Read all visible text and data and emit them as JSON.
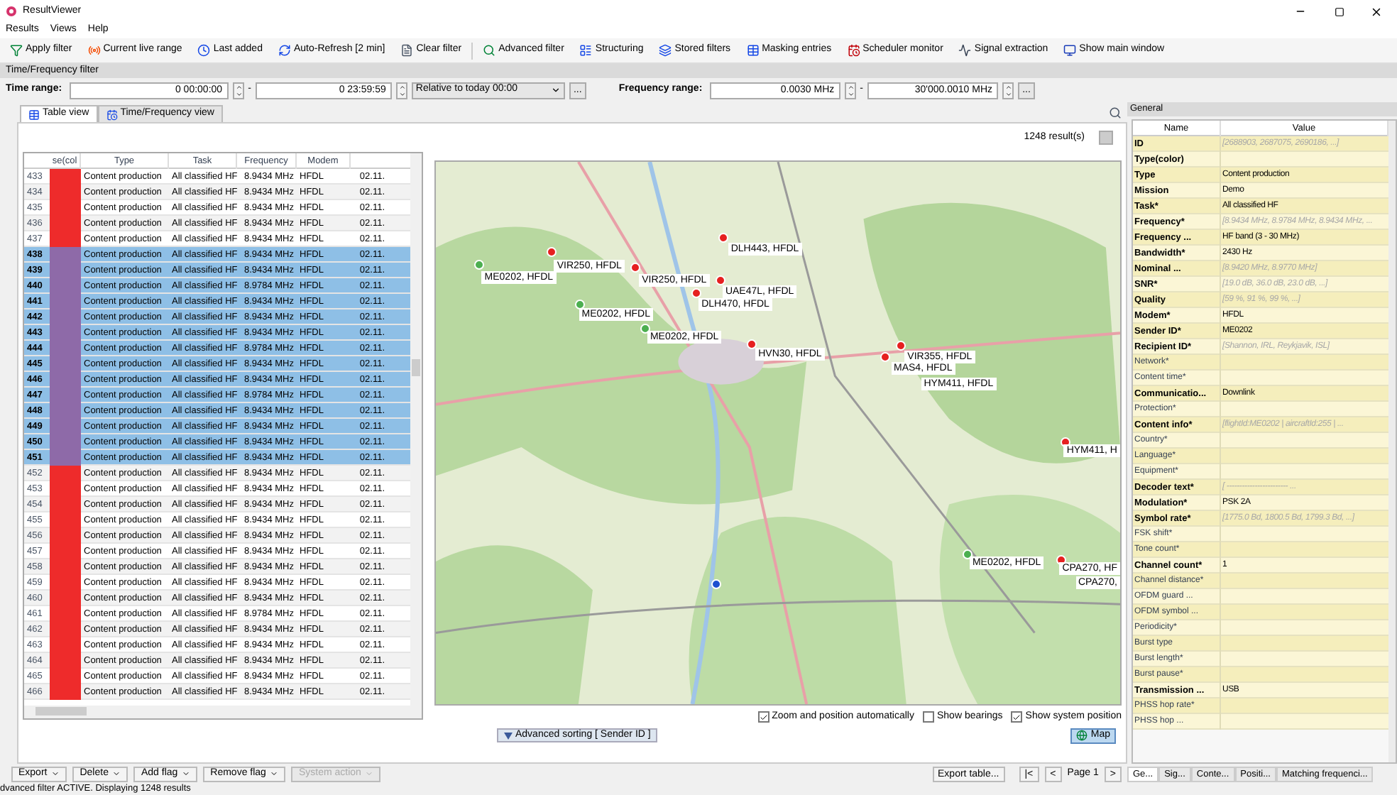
{
  "window": {
    "title": "ResultViewer"
  },
  "menu": [
    "Results",
    "Views",
    "Help"
  ],
  "toolbar": [
    {
      "kind": "apply",
      "label": "Apply filter"
    },
    {
      "kind": "live",
      "label": "Current live range"
    },
    {
      "kind": "last",
      "label": "Last added"
    },
    {
      "kind": "refresh",
      "label": "Auto-Refresh [2 min]"
    },
    {
      "kind": "clear",
      "label": "Clear filter"
    },
    {
      "kind": "advanced",
      "label": "Advanced filter"
    },
    {
      "kind": "structuring",
      "label": "Structuring"
    },
    {
      "kind": "stored",
      "label": "Stored filters"
    },
    {
      "kind": "masking",
      "label": "Masking entries"
    },
    {
      "kind": "scheduler",
      "label": "Scheduler monitor"
    },
    {
      "kind": "signal",
      "label": "Signal extraction"
    },
    {
      "kind": "main",
      "label": "Show main window"
    }
  ],
  "filter": {
    "title": "Time/Frequency filter",
    "time_label": "Time range:",
    "time_from": "0 00:00:00",
    "time_to": "0 23:59:59",
    "relative": "Relative to today 00:00",
    "more": "...",
    "separator": "-",
    "freq_label": "Frequency range:",
    "freq_from": "0.0030 MHz",
    "freq_to": "30'000.0010 MHz"
  },
  "tabs": [
    {
      "label": "Table view",
      "selected": true
    },
    {
      "label": "Time/Frequency view",
      "selected": false
    }
  ],
  "results_count": "1248 result(s)",
  "table": {
    "columns": [
      "se(col",
      "Type",
      "Task",
      "Frequency",
      "Modem"
    ],
    "rows": [
      {
        "cells": [
          "433",
          "Content production",
          "All classified HF",
          "8.9434 MHz",
          "HFDL",
          "02.11."
        ],
        "color": "#ee2b2b",
        "selected": false
      },
      {
        "cells": [
          "434",
          "Content production",
          "All classified HF",
          "8.9434 MHz",
          "HFDL",
          "02.11."
        ],
        "color": "#ee2b2b",
        "selected": false
      },
      {
        "cells": [
          "435",
          "Content production",
          "All classified HF",
          "8.9434 MHz",
          "HFDL",
          "02.11."
        ],
        "color": "#ee2b2b",
        "selected": false
      },
      {
        "cells": [
          "436",
          "Content production",
          "All classified HF",
          "8.9434 MHz",
          "HFDL",
          "02.11."
        ],
        "color": "#ee2b2b",
        "selected": false
      },
      {
        "cells": [
          "437",
          "Content production",
          "All classified HF",
          "8.9434 MHz",
          "HFDL",
          "02.11."
        ],
        "color": "#ee2b2b",
        "selected": false
      },
      {
        "cells": [
          "438",
          "Content production",
          "All classified HF",
          "8.9434 MHz",
          "HFDL",
          "02.11."
        ],
        "color": "#8e6aa8",
        "selected": true
      },
      {
        "cells": [
          "439",
          "Content production",
          "All classified HF",
          "8.9434 MHz",
          "HFDL",
          "02.11."
        ],
        "color": "#8e6aa8",
        "selected": true
      },
      {
        "cells": [
          "440",
          "Content production",
          "All classified HF",
          "8.9784 MHz",
          "HFDL",
          "02.11."
        ],
        "color": "#8e6aa8",
        "selected": true
      },
      {
        "cells": [
          "441",
          "Content production",
          "All classified HF",
          "8.9434 MHz",
          "HFDL",
          "02.11."
        ],
        "color": "#8e6aa8",
        "selected": true
      },
      {
        "cells": [
          "442",
          "Content production",
          "All classified HF",
          "8.9434 MHz",
          "HFDL",
          "02.11."
        ],
        "color": "#8e6aa8",
        "selected": true
      },
      {
        "cells": [
          "443",
          "Content production",
          "All classified HF",
          "8.9434 MHz",
          "HFDL",
          "02.11."
        ],
        "color": "#8e6aa8",
        "selected": true
      },
      {
        "cells": [
          "444",
          "Content production",
          "All classified HF",
          "8.9784 MHz",
          "HFDL",
          "02.11."
        ],
        "color": "#8e6aa8",
        "selected": true
      },
      {
        "cells": [
          "445",
          "Content production",
          "All classified HF",
          "8.9434 MHz",
          "HFDL",
          "02.11."
        ],
        "color": "#8e6aa8",
        "selected": true
      },
      {
        "cells": [
          "446",
          "Content production",
          "All classified HF",
          "8.9434 MHz",
          "HFDL",
          "02.11."
        ],
        "color": "#8e6aa8",
        "selected": true
      },
      {
        "cells": [
          "447",
          "Content production",
          "All classified HF",
          "8.9784 MHz",
          "HFDL",
          "02.11."
        ],
        "color": "#8e6aa8",
        "selected": true
      },
      {
        "cells": [
          "448",
          "Content production",
          "All classified HF",
          "8.9434 MHz",
          "HFDL",
          "02.11."
        ],
        "color": "#8e6aa8",
        "selected": true
      },
      {
        "cells": [
          "449",
          "Content production",
          "All classified HF",
          "8.9434 MHz",
          "HFDL",
          "02.11."
        ],
        "color": "#8e6aa8",
        "selected": true
      },
      {
        "cells": [
          "450",
          "Content production",
          "All classified HF",
          "8.9434 MHz",
          "HFDL",
          "02.11."
        ],
        "color": "#8e6aa8",
        "selected": true
      },
      {
        "cells": [
          "451",
          "Content production",
          "All classified HF",
          "8.9434 MHz",
          "HFDL",
          "02.11."
        ],
        "color": "#8e6aa8",
        "selected": true
      },
      {
        "cells": [
          "452",
          "Content production",
          "All classified HF",
          "8.9434 MHz",
          "HFDL",
          "02.11."
        ],
        "color": "#ee2b2b",
        "selected": false
      },
      {
        "cells": [
          "453",
          "Content production",
          "All classified HF",
          "8.9434 MHz",
          "HFDL",
          "02.11."
        ],
        "color": "#ee2b2b",
        "selected": false
      },
      {
        "cells": [
          "454",
          "Content production",
          "All classified HF",
          "8.9434 MHz",
          "HFDL",
          "02.11."
        ],
        "color": "#ee2b2b",
        "selected": false
      },
      {
        "cells": [
          "455",
          "Content production",
          "All classified HF",
          "8.9434 MHz",
          "HFDL",
          "02.11."
        ],
        "color": "#ee2b2b",
        "selected": false
      },
      {
        "cells": [
          "456",
          "Content production",
          "All classified HF",
          "8.9434 MHz",
          "HFDL",
          "02.11."
        ],
        "color": "#ee2b2b",
        "selected": false
      },
      {
        "cells": [
          "457",
          "Content production",
          "All classified HF",
          "8.9434 MHz",
          "HFDL",
          "02.11."
        ],
        "color": "#ee2b2b",
        "selected": false
      },
      {
        "cells": [
          "458",
          "Content production",
          "All classified HF",
          "8.9434 MHz",
          "HFDL",
          "02.11."
        ],
        "color": "#ee2b2b",
        "selected": false
      },
      {
        "cells": [
          "459",
          "Content production",
          "All classified HF",
          "8.9434 MHz",
          "HFDL",
          "02.11."
        ],
        "color": "#ee2b2b",
        "selected": false
      },
      {
        "cells": [
          "460",
          "Content production",
          "All classified HF",
          "8.9434 MHz",
          "HFDL",
          "02.11."
        ],
        "color": "#ee2b2b",
        "selected": false
      },
      {
        "cells": [
          "461",
          "Content production",
          "All classified HF",
          "8.9784 MHz",
          "HFDL",
          "02.11."
        ],
        "color": "#ee2b2b",
        "selected": false
      },
      {
        "cells": [
          "462",
          "Content production",
          "All classified HF",
          "8.9434 MHz",
          "HFDL",
          "02.11."
        ],
        "color": "#ee2b2b",
        "selected": false
      },
      {
        "cells": [
          "463",
          "Content production",
          "All classified HF",
          "8.9434 MHz",
          "HFDL",
          "02.11."
        ],
        "color": "#ee2b2b",
        "selected": false
      },
      {
        "cells": [
          "464",
          "Content production",
          "All classified HF",
          "8.9434 MHz",
          "HFDL",
          "02.11."
        ],
        "color": "#ee2b2b",
        "selected": false
      },
      {
        "cells": [
          "465",
          "Content production",
          "All classified HF",
          "8.9434 MHz",
          "HFDL",
          "02.11."
        ],
        "color": "#ee2b2b",
        "selected": false
      },
      {
        "cells": [
          "466",
          "Content production",
          "All classified HF",
          "8.9434 MHz",
          "HFDL",
          "02.11."
        ],
        "color": "#ee2b2b",
        "selected": false
      }
    ]
  },
  "map": {
    "kind": "picture",
    "markers": [
      {
        "color": "#4caf50"
      },
      {
        "color": "#e62020"
      },
      {
        "color": "#e62020"
      },
      {
        "color": "#e62020"
      },
      {
        "color": "#e62020"
      },
      {
        "color": "#e62020"
      },
      {
        "color": "#4caf50"
      },
      {
        "color": "#4caf50"
      },
      {
        "color": "#e62020"
      },
      {
        "color": "#e62020"
      },
      {
        "color": "#e62020"
      },
      {
        "color": "#e62020"
      },
      {
        "color": "#4caf50"
      },
      {
        "color": "#e62020"
      },
      {
        "color": "#1e4fd0"
      }
    ],
    "labels": [
      "ME0202, HFDL",
      "VIR250, HFDL",
      "VIR250, HFDL",
      "DLH443, HFDL",
      "UAE47L, HFDL",
      "DLH470, HFDL",
      "ME0202, HFDL",
      "ME0202, HFDL",
      "HVN30, HFDL",
      "VIR355, HFDL",
      "MAS4, HFDL",
      "HYM411, HFDL",
      "HYM411, H",
      "ME0202, HFDL",
      "CPA270, HF",
      "CPA270,"
    ]
  },
  "map_options": [
    {
      "label": "Zoom and position automatically",
      "checked": true
    },
    {
      "label": "Show bearings",
      "checked": false
    },
    {
      "label": "Show system position",
      "checked": true
    }
  ],
  "sorting_button": "Advanced sorting [ Sender ID ]",
  "map_button": "Map",
  "actions": [
    {
      "label": "Export",
      "disabled": false
    },
    {
      "label": "Delete",
      "disabled": false
    },
    {
      "label": "Add flag",
      "disabled": false
    },
    {
      "label": "Remove flag",
      "disabled": false
    },
    {
      "label": "System action",
      "disabled": true
    }
  ],
  "export_table": "Export table...",
  "pagination": {
    "first": "|<",
    "prev": "<",
    "page": "Page 1",
    "next": ">"
  },
  "status_bar": "dvanced filter ACTIVE. Displaying 1248 results",
  "panel": {
    "title": "General",
    "columns": [
      "Name",
      "Value"
    ],
    "rows": [
      {
        "name": "ID",
        "value": "[2688903, 2687075, 2690186, ...]",
        "bold": true,
        "multiple": true
      },
      {
        "name": "Type(color)",
        "bold": true
      },
      {
        "name": "Type",
        "value": "Content production",
        "bold": true,
        "multiple": false
      },
      {
        "name": "Mission",
        "value": "Demo",
        "bold": true,
        "multiple": false
      },
      {
        "name": "Task*",
        "value": "All classified HF",
        "bold": true,
        "multiple": false
      },
      {
        "name": "Frequency*",
        "value": "[8.9434 MHz, 8.9784 MHz, 8.9434 MHz, ...",
        "bold": true,
        "multiple": true
      },
      {
        "name": "Frequency ...",
        "value": "HF band (3 - 30 MHz)",
        "bold": true,
        "multiple": false
      },
      {
        "name": "Bandwidth*",
        "value": "2430 Hz",
        "bold": true,
        "multiple": false
      },
      {
        "name": "Nominal ...",
        "value": "[8.9420 MHz, 8.9770 MHz]",
        "bold": true,
        "multiple": true
      },
      {
        "name": "SNR*",
        "value": "[19.0 dB, 36.0 dB, 23.0 dB, ...]",
        "bold": true,
        "multiple": true
      },
      {
        "name": "Quality",
        "value": "[59 %, 91 %, 99 %, ...]",
        "bold": true,
        "multiple": true
      },
      {
        "name": "Modem*",
        "value": "HFDL",
        "bold": true,
        "multiple": false
      },
      {
        "name": "Sender ID*",
        "value": "ME0202",
        "bold": true,
        "multiple": false
      },
      {
        "name": "Recipient ID*",
        "value": "[Shannon, IRL, Reykjavik, ISL]",
        "bold": true,
        "multiple": true
      },
      {
        "name": "Network*",
        "bold": false
      },
      {
        "name": "Content time*",
        "bold": false
      },
      {
        "name": "Communicatio...",
        "value": "Downlink",
        "bold": true,
        "multiple": false
      },
      {
        "name": "Protection*",
        "bold": false
      },
      {
        "name": "Content info*",
        "value": "[flightId:ME0202 | aircraftId:255 | ...",
        "bold": true,
        "multiple": true
      },
      {
        "name": "Country*",
        "bold": false
      },
      {
        "name": "Language*",
        "bold": false
      },
      {
        "name": "Equipment*",
        "bold": false
      },
      {
        "name": "Decoder text*",
        "value": "[ ------------------------ ...",
        "bold": true,
        "multiple": true
      },
      {
        "name": "Modulation*",
        "value": "PSK 2A",
        "bold": true,
        "multiple": false
      },
      {
        "name": "Symbol rate*",
        "value": "[1775.0 Bd, 1800.5 Bd, 1799.3 Bd, ...]",
        "bold": true,
        "multiple": true
      },
      {
        "name": "FSK shift*",
        "bold": false
      },
      {
        "name": "Tone count*",
        "bold": false
      },
      {
        "name": "Channel count*",
        "value": "1",
        "bold": true,
        "multiple": false
      },
      {
        "name": "Channel distance*",
        "bold": false
      },
      {
        "name": "OFDM guard ...",
        "bold": false
      },
      {
        "name": "OFDM symbol ...",
        "bold": false
      },
      {
        "name": "Periodicity*",
        "bold": false
      },
      {
        "name": "Burst type",
        "bold": false
      },
      {
        "name": "Burst length*",
        "bold": false
      },
      {
        "name": "Burst pause*",
        "bold": false
      },
      {
        "name": "Transmission ...",
        "value": "USB",
        "bold": true,
        "multiple": false
      },
      {
        "name": "PHSS hop rate*",
        "bold": false
      },
      {
        "name": "PHSS hop ...",
        "bold": false
      }
    ]
  },
  "panel_tabs": [
    {
      "label": "Ge...",
      "selected": true
    },
    {
      "label": "Sig...",
      "selected": false
    },
    {
      "label": "Conte...",
      "selected": false
    },
    {
      "label": "Positi...",
      "selected": false
    },
    {
      "label": "Matching frequenci...",
      "selected": false
    }
  ]
}
